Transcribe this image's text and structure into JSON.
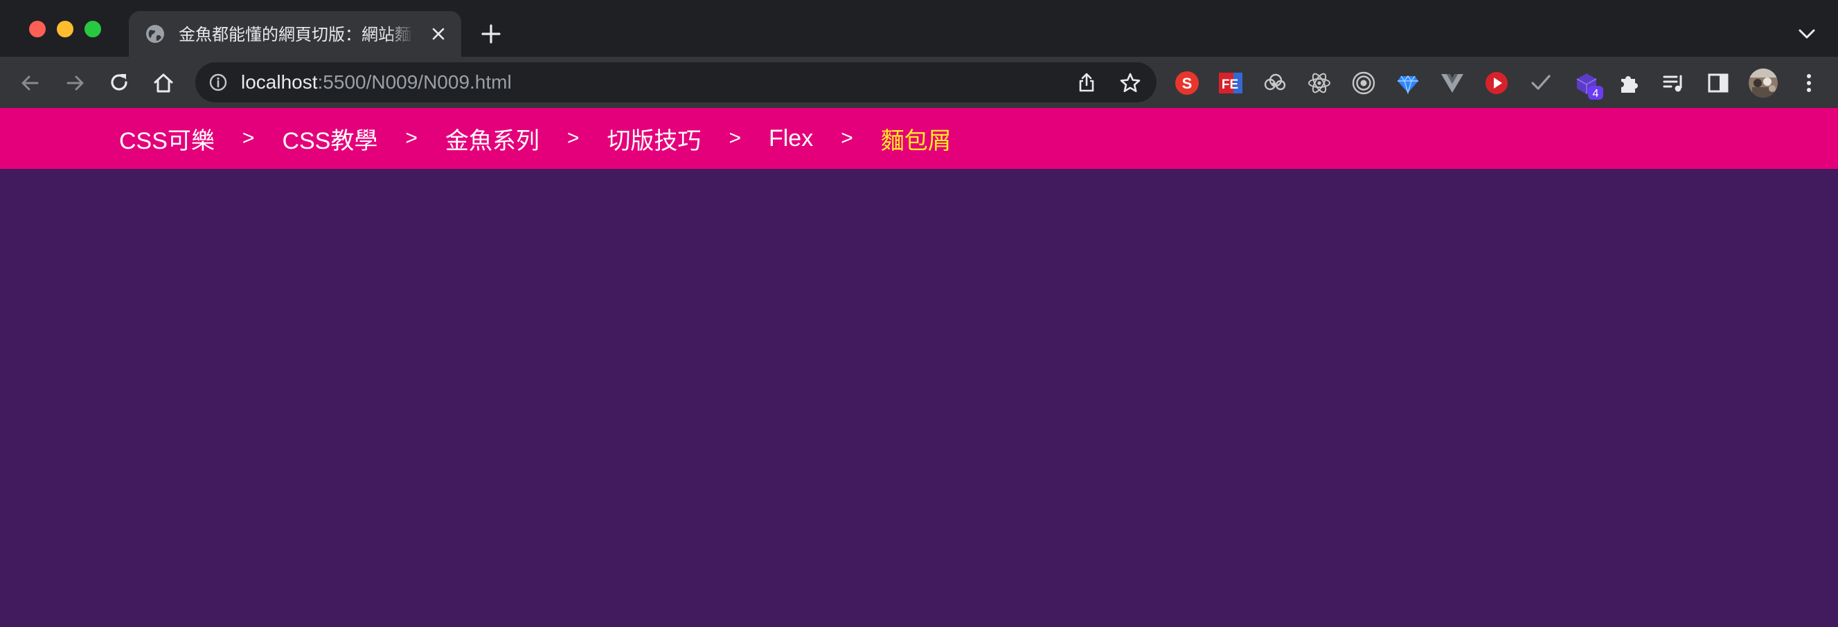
{
  "browser": {
    "tab": {
      "title": "金魚都能懂的網頁切版：網站麵包屑",
      "favicon": "globe-icon",
      "close_icon": "close-icon"
    },
    "new_tab_icon": "plus-icon",
    "tab_list_icon": "chevron-down-icon",
    "nav": {
      "back": "arrow-left-icon",
      "forward": "arrow-right-icon",
      "reload": "reload-icon",
      "home": "home-icon"
    },
    "address": {
      "host": "localhost",
      "rest": ":5500/N009/N009.html",
      "info_icon": "info-icon",
      "share_icon": "share-icon",
      "bookmark_icon": "star-icon"
    },
    "extensions": [
      {
        "name": "s-extension-icon",
        "color": "#e8352e",
        "text": "S"
      },
      {
        "name": "fe-extension-icon",
        "color": "#d7222c",
        "text": "FE"
      },
      {
        "name": "cloud-extension-icon",
        "color": "#c7c7c7"
      },
      {
        "name": "react-devtools-icon",
        "color": "#c7c7c7"
      },
      {
        "name": "target-extension-icon",
        "color": "#c7c7c7"
      },
      {
        "name": "gem-extension-icon",
        "color": "#3aa0ff"
      },
      {
        "name": "vue-devtools-icon",
        "color": "#9aa0a6"
      },
      {
        "name": "play-extension-icon",
        "color": "#d7222c"
      },
      {
        "name": "check-extension-icon",
        "color": "#9aa0a6"
      },
      {
        "name": "cube-extension-icon",
        "color": "#5b3cc4",
        "badge": "4"
      }
    ],
    "puzzle_icon": "puzzle-icon",
    "playlist_icon": "playlist-icon",
    "sidepanel_icon": "sidepanel-icon",
    "avatar_icon": "avatar",
    "menu_icon": "kebab-menu-icon"
  },
  "breadcrumb": {
    "items": [
      {
        "label": "CSS可樂"
      },
      {
        "label": "CSS教學"
      },
      {
        "label": "金魚系列"
      },
      {
        "label": "切版技巧"
      },
      {
        "label": "Flex"
      }
    ],
    "current": "麵包屑",
    "separator": ">"
  },
  "colors": {
    "nav_bg": "#e5007b",
    "page_bg": "#421a5e",
    "current_crumb": "#ffed1c",
    "link": "#ffffff"
  }
}
